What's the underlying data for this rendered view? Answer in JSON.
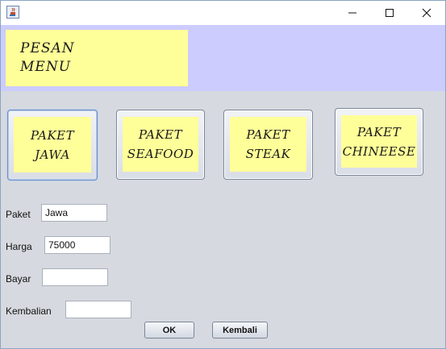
{
  "window": {
    "icon": "java-coffee-icon",
    "controls": {
      "minimize": "minimize-icon",
      "maximize": "maximize-icon",
      "close": "close-icon"
    }
  },
  "header": {
    "title": "PESAN\nMENU"
  },
  "menu_buttons": [
    {
      "label": "PAKET\nJAWA",
      "selected": true
    },
    {
      "label": "PAKET\nSEAFOOD",
      "selected": false
    },
    {
      "label": "PAKET\nSTEAK",
      "selected": false
    },
    {
      "label": "PAKET\nCHINEESE",
      "selected": false
    }
  ],
  "form": {
    "paket": {
      "label": "Paket",
      "value": "Jawa"
    },
    "harga": {
      "label": "Harga",
      "value": "75000"
    },
    "bayar": {
      "label": "Bayar",
      "value": ""
    },
    "kembalian": {
      "label": "Kembalian",
      "value": ""
    }
  },
  "actions": {
    "ok": "OK",
    "kembali": "Kembali"
  },
  "colors": {
    "header_band": "#ccccff",
    "label_yellow": "#ffff99",
    "window_bg": "#d6d9df"
  }
}
